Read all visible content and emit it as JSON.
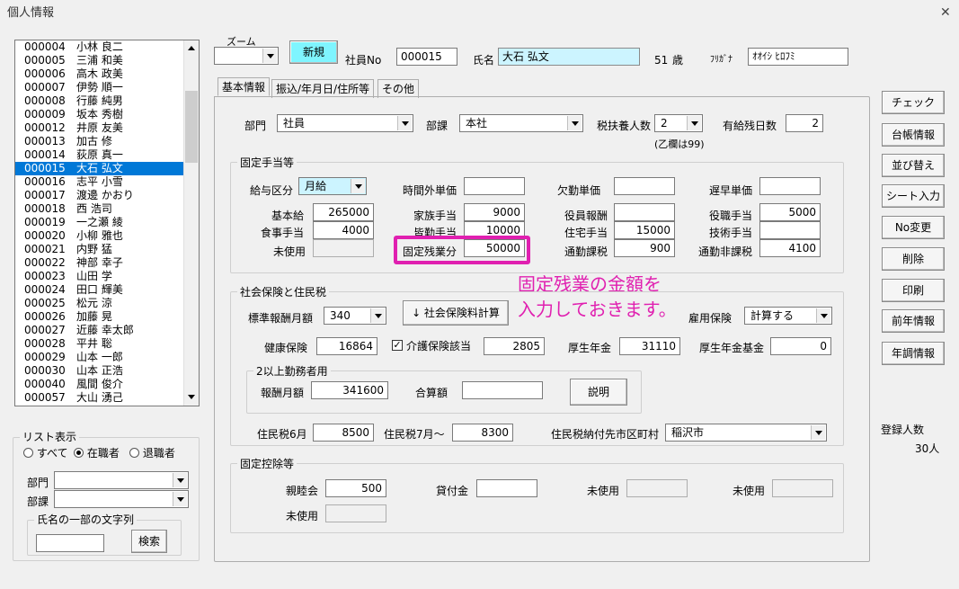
{
  "window": {
    "title": "個人情報",
    "close_glyph": "✕"
  },
  "employee_list": {
    "rows": [
      {
        "code": "000004",
        "name": "小林 良二"
      },
      {
        "code": "000005",
        "name": "三浦 和美"
      },
      {
        "code": "000006",
        "name": "高木 政美"
      },
      {
        "code": "000007",
        "name": "伊勢 順一"
      },
      {
        "code": "000008",
        "name": "行藤 純男"
      },
      {
        "code": "000009",
        "name": "坂本 秀樹"
      },
      {
        "code": "000012",
        "name": "井原 友美"
      },
      {
        "code": "000013",
        "name": "加古 修"
      },
      {
        "code": "000014",
        "name": "荻原 真一"
      },
      {
        "code": "000015",
        "name": "大石 弘文"
      },
      {
        "code": "000016",
        "name": "志平 小雪"
      },
      {
        "code": "000017",
        "name": "渡邊 かおり"
      },
      {
        "code": "000018",
        "name": "西 浩司"
      },
      {
        "code": "000019",
        "name": "一之瀬 綾"
      },
      {
        "code": "000020",
        "name": "小柳 雅也"
      },
      {
        "code": "000021",
        "name": "内野 猛"
      },
      {
        "code": "000022",
        "name": "神部 幸子"
      },
      {
        "code": "000023",
        "name": "山田 学"
      },
      {
        "code": "000024",
        "name": "田口 輝美"
      },
      {
        "code": "000025",
        "name": "松元 涼"
      },
      {
        "code": "000026",
        "name": "加藤 晃"
      },
      {
        "code": "000027",
        "name": "近藤 幸太郎"
      },
      {
        "code": "000028",
        "name": "平井 聡"
      },
      {
        "code": "000029",
        "name": "山本 一郎"
      },
      {
        "code": "000030",
        "name": "山本 正浩"
      },
      {
        "code": "000040",
        "name": "風間 俊介"
      },
      {
        "code": "000057",
        "name": "大山 湧己"
      }
    ]
  },
  "list_filter": {
    "title": "リスト表示",
    "radio_all": "すべて",
    "radio_active": "在職者",
    "radio_retired": "退職者",
    "dept_label": "部門",
    "section_label": "部課",
    "name_search_title": "氏名の一部の文字列",
    "search_button": "検索"
  },
  "header": {
    "zoom_label": "ズーム",
    "new_button": "新規",
    "emp_no_label": "社員No",
    "emp_no": "000015",
    "name_label": "氏名",
    "name": "大石 弘文",
    "age": "51",
    "age_unit": "歳",
    "furigana_label": "ﾌﾘｶﾞﾅ",
    "furigana": "ｵｵｲｼ ﾋﾛﾌﾐ"
  },
  "tabs": [
    "基本情報",
    "振込/年月日/住所等",
    "その他"
  ],
  "basic": {
    "dept_label": "部門",
    "dept": "社員",
    "section_label": "部課",
    "section": "本社",
    "dependents_label": "税扶養人数",
    "dependents": "2",
    "dependents_note": "(乙欄は99)",
    "paid_leave_label": "有給残日数",
    "paid_leave": "2"
  },
  "fixed_allowance": {
    "title": "固定手当等",
    "pay_type_label": "給与区分",
    "pay_type": "月給",
    "overtime_rate_label": "時間外単価",
    "overtime_rate": "",
    "absence_rate_label": "欠勤単価",
    "absence_rate": "",
    "late_rate_label": "遅早単価",
    "late_rate": "",
    "base_pay_label": "基本給",
    "base_pay": "265000",
    "family_label": "家族手当",
    "family": "9000",
    "officer_label": "役員報酬",
    "officer": "",
    "position_label": "役職手当",
    "position": "5000",
    "meal_label": "食事手当",
    "meal": "4000",
    "attendance_label": "皆勤手当",
    "attendance": "10000",
    "housing_label": "住宅手当",
    "housing": "15000",
    "skill_label": "技術手当",
    "skill": "",
    "unused_label": "未使用",
    "unused": "",
    "fixed_ot_label": "固定残業分",
    "fixed_ot": "50000",
    "commute_tax_label": "通勤課税",
    "commute_tax": "900",
    "commute_free_label": "通勤非課税",
    "commute_free": "4100"
  },
  "annotation": {
    "line1": "固定残業の金額を",
    "line2": "入力しておきます。",
    "color": "#e020b0"
  },
  "insurance": {
    "title": "社会保険と住民税",
    "std_monthly_label": "標準報酬月額",
    "std_monthly": "340",
    "calc_button": "↓ 社会保険料計算",
    "employment_label": "雇用保険",
    "employment": "計算する",
    "health_label": "健康保険",
    "health": "16864",
    "care_label": "介護保険該当",
    "care_checked": "✓",
    "care": "2805",
    "pension_label": "厚生年金",
    "pension": "31110",
    "pension_fund_label": "厚生年金基金",
    "pension_fund": "0",
    "multi_title": "2以上勤務者用",
    "remun_label": "報酬月額",
    "remun": "341600",
    "total_label": "合算額",
    "total": "",
    "explain_button": "説明",
    "res_june_label": "住民税6月",
    "res_june": "8500",
    "res_july_label": "住民税7月～",
    "res_july": "8300",
    "res_city_label": "住民税納付先市区町村",
    "res_city": "稲沢市"
  },
  "deduction": {
    "title": "固定控除等",
    "social_label": "親睦会",
    "social": "500",
    "loan_label": "貸付金",
    "loan": "",
    "unused1_label": "未使用",
    "unused1": "",
    "unused2_label": "未使用",
    "unused2": "",
    "unused3_label": "未使用",
    "unused3": ""
  },
  "side_buttons": [
    "チェック",
    "台帳情報",
    "並び替え",
    "シート入力",
    "No変更",
    "削除",
    "印刷",
    "前年情報",
    "年調情報"
  ],
  "registered": {
    "label": "登録人数",
    "count": "30人"
  }
}
